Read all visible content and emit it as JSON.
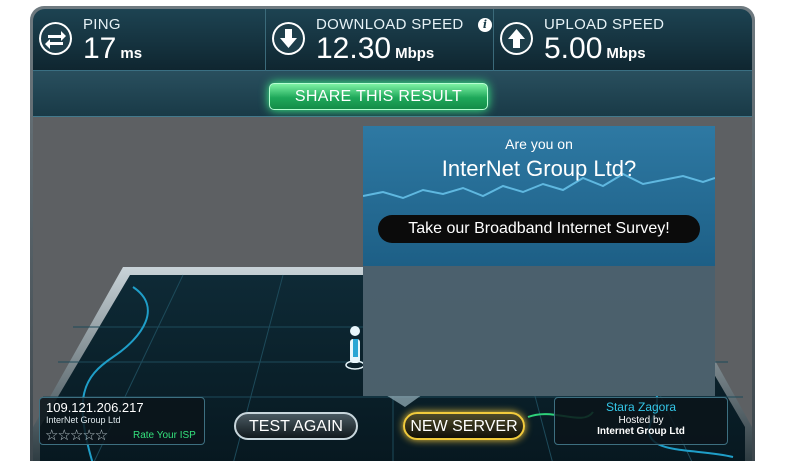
{
  "stats": {
    "ping": {
      "label": "PING",
      "value": "17",
      "unit": "ms",
      "icon": "ping-arrows-icon"
    },
    "download": {
      "label": "DOWNLOAD SPEED",
      "value": "12.30",
      "unit": "Mbps",
      "icon": "download-arrow-icon",
      "info": "i"
    },
    "upload": {
      "label": "UPLOAD SPEED",
      "value": "5.00",
      "unit": "Mbps",
      "icon": "upload-arrow-icon"
    }
  },
  "share": {
    "label": "SHARE THIS RESULT"
  },
  "ad": {
    "question": "Are you on",
    "isp_name": "InterNet Group Ltd?",
    "survey_label": "Take our Broadband Internet Survey!"
  },
  "client": {
    "ip": "109.121.206.217",
    "isp": "InterNet Group Ltd",
    "stars": "☆☆☆☆☆",
    "rate_label": "Rate Your ISP"
  },
  "buttons": {
    "test_again": "TEST AGAIN",
    "new_server": "NEW SERVER"
  },
  "server": {
    "city": "Stara Zagora",
    "hosted_by": "Hosted by",
    "host": "Internet Group Ltd"
  },
  "colors": {
    "accent_green": "#1ea85a",
    "accent_gold": "#f2cb3c",
    "city_blue": "#34c7e8",
    "rate_green": "#34e07c"
  }
}
